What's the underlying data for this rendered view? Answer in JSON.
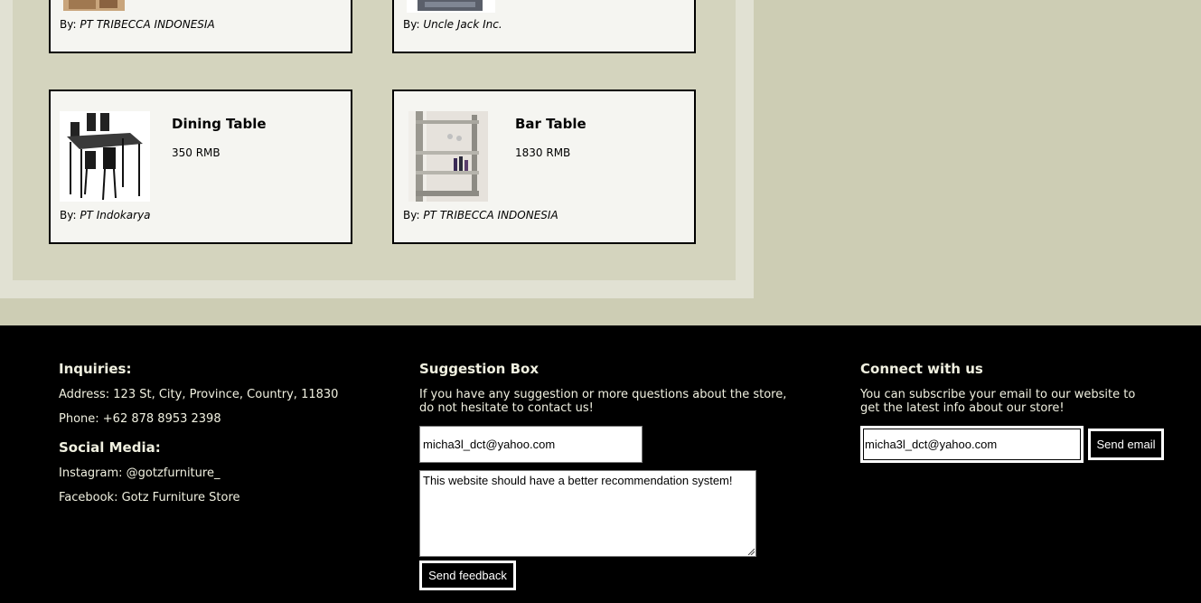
{
  "products": {
    "top_row": [
      {
        "brand_prefix": "By:",
        "brand": "PT TRIBECCA INDONESIA"
      },
      {
        "brand_prefix": "By:",
        "brand": "Uncle Jack Inc."
      }
    ],
    "bottom_row": [
      {
        "name": "Dining Table",
        "price": "350 RMB",
        "brand_prefix": "By:",
        "brand": "PT Indokarya"
      },
      {
        "name": "Bar Table",
        "price": "1830 RMB",
        "brand_prefix": "By:",
        "brand": "PT TRIBECCA INDONESIA"
      }
    ]
  },
  "footer": {
    "inquiries": {
      "heading": "Inquiries:",
      "address": "Address: 123 St, City, Province, Country, 11830",
      "phone": "Phone: +62 878 8953 2398"
    },
    "social": {
      "heading": "Social Media:",
      "instagram": "Instagram: @gotzfurniture_",
      "facebook": "Facebook: Gotz Furniture Store"
    },
    "suggestion": {
      "heading": "Suggestion Box",
      "text_line1": "If you have any suggestion or more questions about the store,",
      "text_line2": "do not hesitate to contact us!",
      "email_value": "micha3l_dct@yahoo.com",
      "message_value": "This website should have a better recommendation system!",
      "button_label": "Send feedback"
    },
    "connect": {
      "heading": "Connect with us",
      "text_line1": "You can subscribe your email to our website to",
      "text_line2": "get the latest info about our store!",
      "email_value": "micha3l_dct@yahoo.com",
      "button_label": "Send email"
    }
  },
  "colors": {
    "page_bg": "#cdcdb4",
    "panel_outer": "#e1e1d3",
    "panel_inner": "#d4d4be",
    "card_bg": "#f5f5f1",
    "footer_bg": "#000000",
    "footer_text": "#f0f0e0"
  }
}
